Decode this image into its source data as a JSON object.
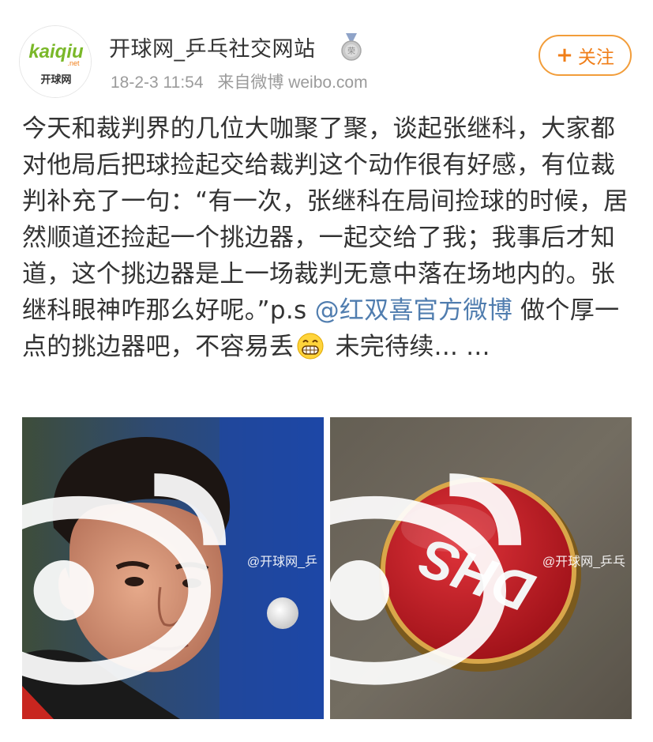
{
  "post": {
    "author": "开球网_乒乓社交网站",
    "avatar": {
      "brand": "kaiqiu",
      "brand_suffix": ".net",
      "caption": "开球网"
    },
    "timestamp": "18-2-3 11:54",
    "source": "来自微博 weibo.com",
    "follow_button": {
      "plus": "+",
      "label": "关注"
    },
    "text": {
      "part1": "今天和裁判界的几位大咖聚了聚，谈起张继科，大家都对他局后把球捡起交给裁判这个动作很有好感，有位裁判补充了一句：“有一次，张继科在局间捡球的时候，居然顺道还捡起一个挑边器，一起交给了我；我事后才知道，这个挑边器是上一场裁判无意中落在场地内的。张继科眼神咋那么好呢。”p.s ",
      "mention": "@红双喜官方微博",
      "part2": " 做个厚一点的挑边器吧，不容易丢",
      "part3": "  未完待续... ..."
    },
    "images": [
      {
        "watermark": "@开球网_乒",
        "icon": "table-tennis-player-photo"
      },
      {
        "watermark": "@开球网_乒乓",
        "icon": "dhs-coin-photo",
        "coin_text": "DHS"
      }
    ]
  },
  "colors": {
    "accent_orange": "#f07e18",
    "link_blue": "#507daf",
    "meta_gray": "#9b9b9b"
  }
}
